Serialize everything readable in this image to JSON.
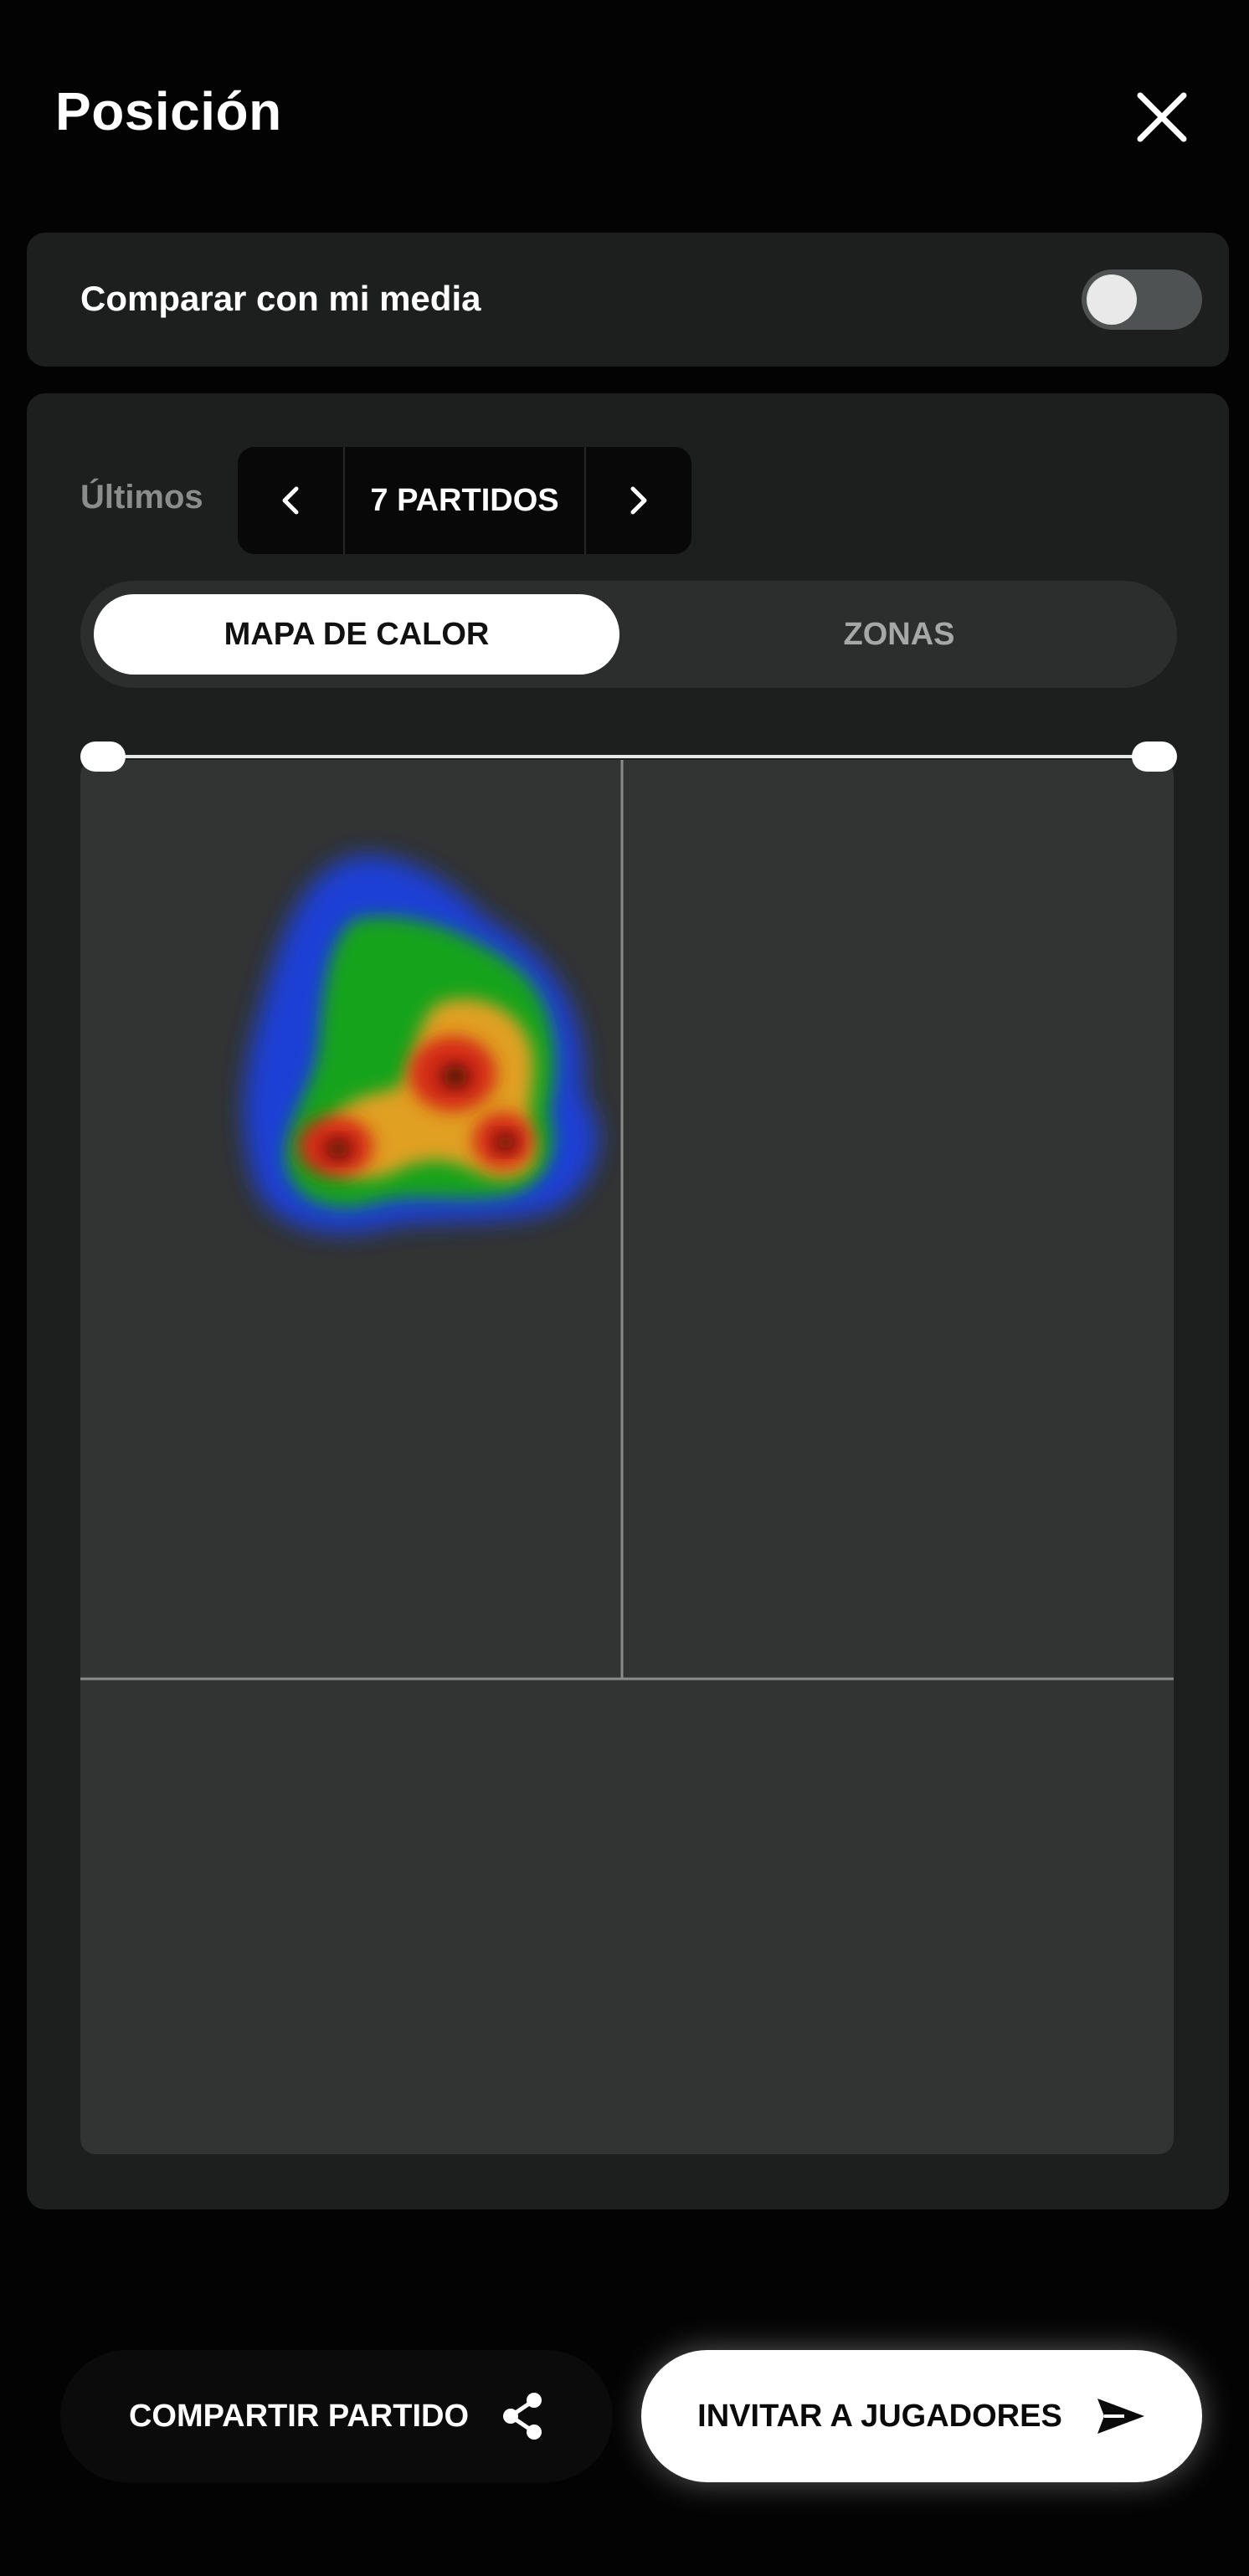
{
  "header": {
    "title": "Posición"
  },
  "compare": {
    "label": "Comparar con mi media",
    "enabled": false
  },
  "filter": {
    "label": "Últimos",
    "value": "7 PARTIDOS"
  },
  "view_tabs": [
    {
      "label": "MAPA DE CALOR",
      "active": true
    },
    {
      "label": "ZONAS",
      "active": false
    }
  ],
  "range": {
    "start": 0,
    "end": 1
  },
  "heatmap": {
    "scale_colors": [
      "#1e3fd6",
      "#13a31a",
      "#e0a020",
      "#d42a12",
      "#3a0a06"
    ]
  },
  "actions": {
    "share_label": "COMPARTIR PARTIDO",
    "invite_label": "INVITAR A JUGADORES"
  },
  "icons": {
    "close": "close-icon",
    "prev": "chevron-left-icon",
    "next": "chevron-right-icon",
    "share": "share-icon",
    "send": "send-icon"
  }
}
